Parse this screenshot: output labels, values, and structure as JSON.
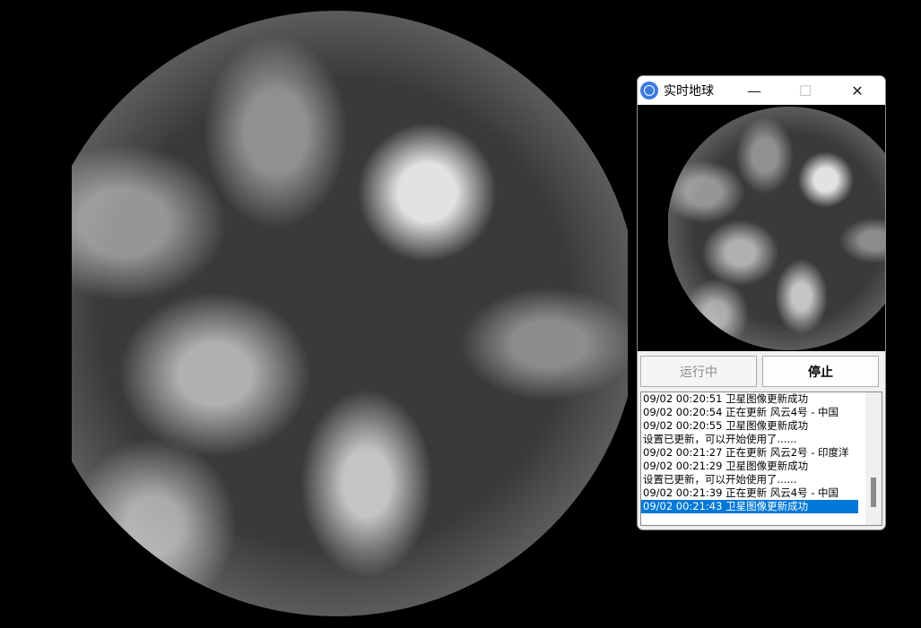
{
  "window": {
    "title": "实时地球",
    "icon": "globe-icon",
    "minimize": "—",
    "maximize": "☐",
    "close": "✕"
  },
  "buttons": {
    "running": "运行中",
    "stop": "停止"
  },
  "log": [
    "09/02 00:20:51 卫星图像更新成功",
    "09/02 00:20:54 正在更新 风云4号 - 中国",
    "09/02 00:20:55 卫星图像更新成功",
    "设置已更新，可以开始使用了......",
    "09/02 00:21:27 正在更新 风云2号 - 印度洋",
    "09/02 00:21:29 卫星图像更新成功",
    "设置已更新，可以开始使用了......",
    "09/02 00:21:39 正在更新 风云4号 - 中国",
    "09/02 00:21:43 卫星图像更新成功"
  ],
  "selected_index": 8,
  "colors": {
    "accent": "#0078d7"
  }
}
